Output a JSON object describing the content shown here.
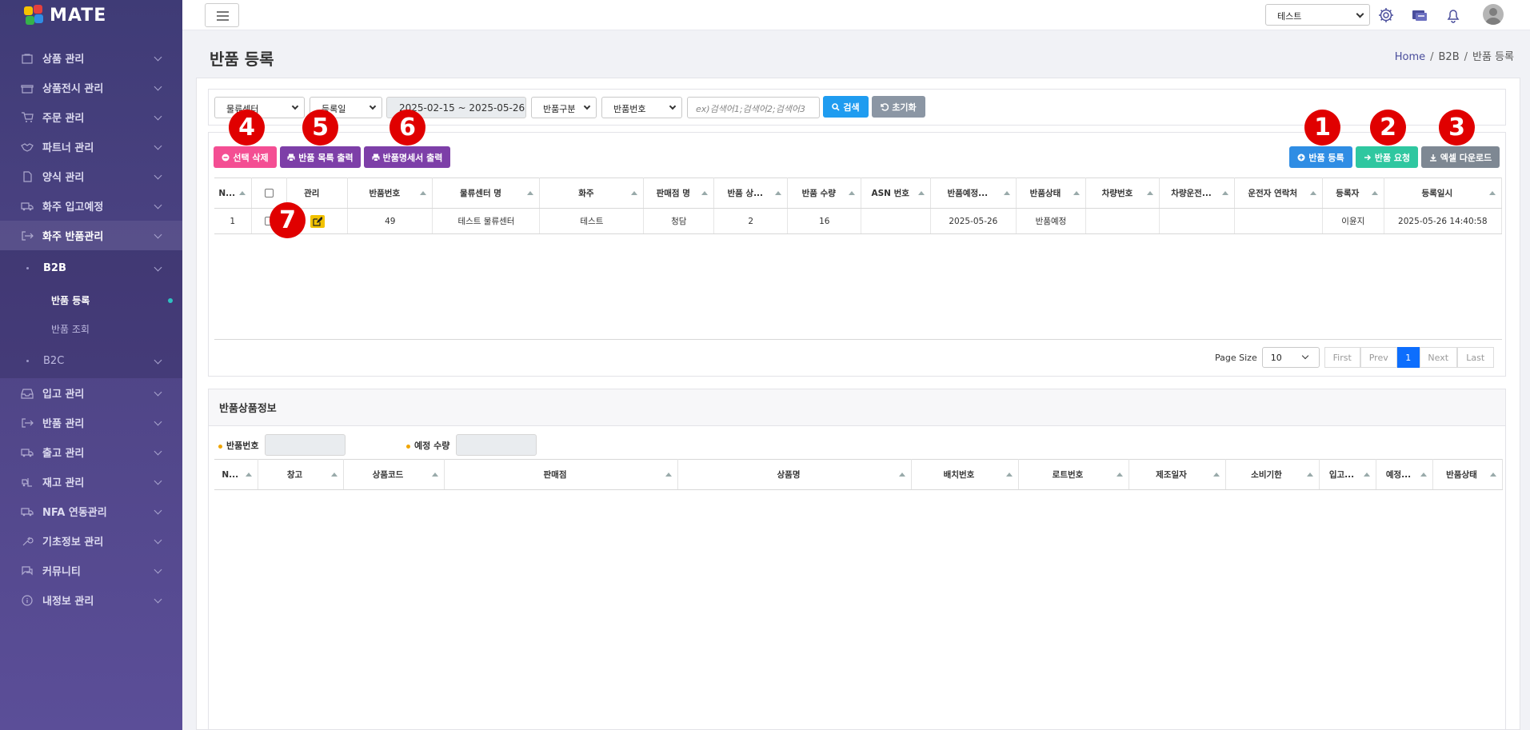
{
  "app": {
    "logo": "MATE"
  },
  "sidebar": {
    "items": [
      {
        "label": "상품 관리",
        "icon": "bag-icon"
      },
      {
        "label": "상품전시 관리",
        "icon": "store-icon"
      },
      {
        "label": "주문 관리",
        "icon": "cart-icon"
      },
      {
        "label": "파트너 관리",
        "icon": "handshake-icon"
      },
      {
        "label": "양식 관리",
        "icon": "document-icon"
      },
      {
        "label": "화주 입고예정",
        "icon": "truck-icon"
      },
      {
        "label": "화주 반품관리",
        "icon": "return-icon"
      }
    ],
    "b2b": {
      "label": "B2B",
      "children": [
        "반품 등록",
        "반품 조회"
      ]
    },
    "b2c": {
      "label": "B2C"
    },
    "items_after": [
      {
        "label": "입고 관리",
        "icon": "inbox-icon"
      },
      {
        "label": "반품 관리",
        "icon": "exit-icon"
      },
      {
        "label": "출고 관리",
        "icon": "truck-out-icon"
      },
      {
        "label": "재고 관리",
        "icon": "forklift-icon"
      },
      {
        "label": "NFA 연동관리",
        "icon": "truck-link-icon"
      },
      {
        "label": "기초정보 관리",
        "icon": "wrench-icon"
      },
      {
        "label": "커뮤니티",
        "icon": "chat-icon"
      },
      {
        "label": "내정보 관리",
        "icon": "info-icon"
      }
    ]
  },
  "topbar": {
    "tenant": "테스트"
  },
  "page": {
    "title": "반품 등록",
    "breadcrumb": [
      "Home",
      "B2B",
      "반품 등록"
    ]
  },
  "filters": {
    "center": "물류센터",
    "date_type": "등록일",
    "date_range": "2025-02-15 ~ 2025-05-26",
    "return_type": "반품구분",
    "search_field": "반품번호",
    "search_placeholder": "ex)검색어1;검색어2;검색어3",
    "search_btn": "검색",
    "reset_btn": "초기화"
  },
  "actions": {
    "delete": "선택 삭제",
    "print_list": "반품 목록 출력",
    "print_detail": "반품명세서 출력",
    "register": "반품 등록",
    "request": "반품 요청",
    "excel": "엑셀 다운로드"
  },
  "badges": [
    "1",
    "2",
    "3",
    "4",
    "5",
    "6",
    "7"
  ],
  "grid": {
    "columns": [
      "N...",
      "",
      "관리",
      "반품번호",
      "물류센터 명",
      "화주",
      "판매점 명",
      "반품 상...",
      "반품 수량",
      "ASN 번호",
      "반품예정...",
      "반품상태",
      "차량번호",
      "차량운전...",
      "운전자 연락처",
      "등록자",
      "등록일시"
    ],
    "rows": [
      [
        "1",
        "",
        "",
        "49",
        "테스트 물류센터",
        "테스트",
        "청담",
        "2",
        "16",
        "",
        "2025-05-26",
        "반품예정",
        "",
        "",
        "",
        "이윤지",
        "2025-05-26 14:40:58"
      ]
    ]
  },
  "pager": {
    "size_label": "Page Size",
    "size": "10",
    "first": "First",
    "prev": "Prev",
    "current": "1",
    "next": "Next",
    "last": "Last"
  },
  "detail": {
    "title": "반품상품정보",
    "return_no_label": "반품번호",
    "qty_label": "예정 수량",
    "columns": [
      "N...",
      "창고",
      "상품코드",
      "판매점",
      "상품명",
      "배치번호",
      "로트번호",
      "제조일자",
      "소비기한",
      "입고...",
      "예정...",
      "반품상태"
    ]
  }
}
